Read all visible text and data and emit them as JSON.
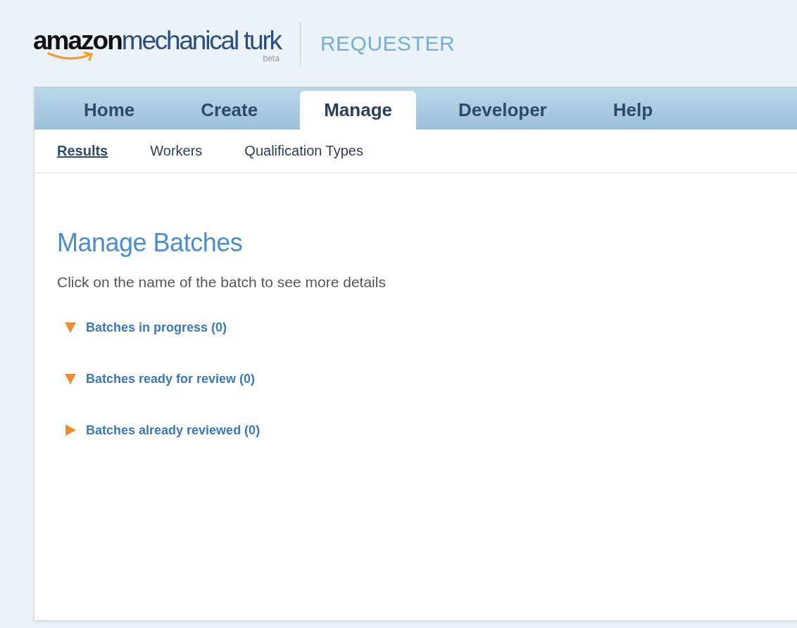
{
  "header": {
    "logo": {
      "brand": "amazon",
      "product": "mechanical turk",
      "badge": "beta"
    },
    "section": "REQUESTER"
  },
  "tabs": [
    {
      "label": "Home",
      "selected": false
    },
    {
      "label": "Create",
      "selected": false
    },
    {
      "label": "Manage",
      "selected": true
    },
    {
      "label": "Developer",
      "selected": false
    },
    {
      "label": "Help",
      "selected": false
    }
  ],
  "subtabs": [
    {
      "label": "Results",
      "selected": true
    },
    {
      "label": "Workers",
      "selected": false
    },
    {
      "label": "Qualification Types",
      "selected": false
    }
  ],
  "page": {
    "title": "Manage Batches",
    "instructions": "Click on the name of the batch to see more details"
  },
  "batch_groups": [
    {
      "label": "Batches in progress (0)",
      "expanded": true
    },
    {
      "label": "Batches ready for review (0)",
      "expanded": true
    },
    {
      "label": "Batches already reviewed (0)",
      "expanded": false
    }
  ]
}
